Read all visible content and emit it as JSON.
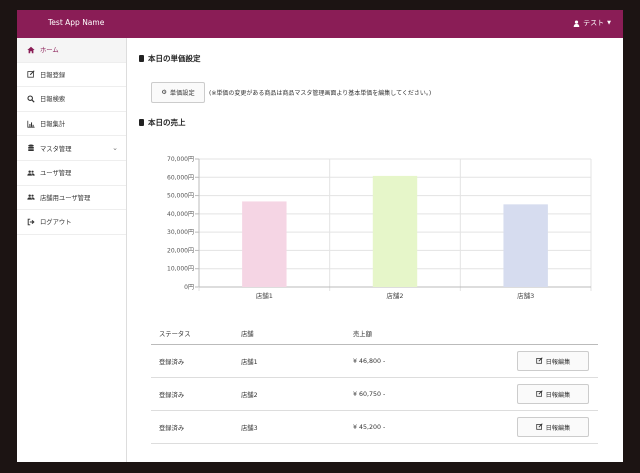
{
  "app": {
    "title": "Test App Name",
    "user_name": "テスト"
  },
  "sidebar": {
    "items": [
      {
        "label": "ホーム",
        "icon": "home-icon",
        "active": true
      },
      {
        "label": "日報登録",
        "icon": "edit-icon"
      },
      {
        "label": "日報検索",
        "icon": "search-icon"
      },
      {
        "label": "日報集計",
        "icon": "bar-chart-icon"
      },
      {
        "label": "マスタ管理",
        "icon": "database-icon",
        "expandable": true
      },
      {
        "label": "ユーザ管理",
        "icon": "users-icon"
      },
      {
        "label": "店舗用ユーザ管理",
        "icon": "users-icon"
      },
      {
        "label": "ログアウト",
        "icon": "sign-out-icon"
      }
    ]
  },
  "unit_price": {
    "title": "本日の単価設定",
    "button_label": "単価設定",
    "note": "(※単価の変更がある商品は商品マスタ管理画面より基本単価を編集してください。)"
  },
  "sales": {
    "title": "本日の売上"
  },
  "chart_data": {
    "type": "bar",
    "categories": [
      "店舗1",
      "店舗2",
      "店舗3"
    ],
    "values": [
      46800,
      60750,
      45200
    ],
    "colors": [
      "#f5d5e4",
      "#e6f6c9",
      "#d6dcef"
    ],
    "ylim": [
      0,
      70000
    ],
    "yticks": [
      "0円",
      "10,000円",
      "20,000円",
      "30,000円",
      "40,000円",
      "50,000円",
      "60,000円",
      "70,000円"
    ],
    "grid": true
  },
  "table": {
    "headers": [
      "ステータス",
      "店舗",
      "売上額"
    ],
    "rows": [
      {
        "status": "登録済み",
        "store": "店舗1",
        "amount": "¥ 46,800 -",
        "action": "日報編集"
      },
      {
        "status": "登録済み",
        "store": "店舗2",
        "amount": "¥ 60,750 -",
        "action": "日報編集"
      },
      {
        "status": "登録済み",
        "store": "店舗3",
        "amount": "¥ 45,200 -",
        "action": "日報編集"
      }
    ]
  }
}
